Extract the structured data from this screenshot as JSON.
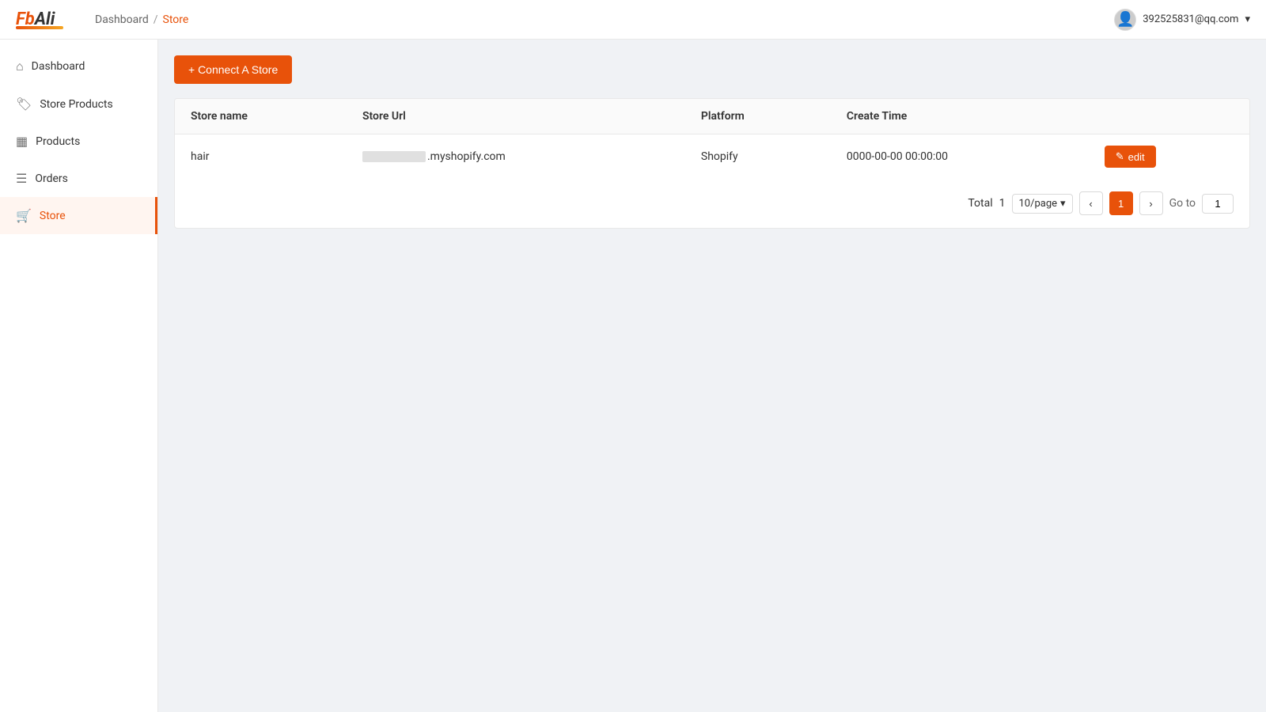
{
  "header": {
    "logo": "FbAli",
    "breadcrumb": {
      "home": "Dashboard",
      "separator": "/",
      "current": "Store"
    },
    "user": {
      "email": "392525831@qq.com",
      "dropdown_icon": "▾"
    }
  },
  "sidebar": {
    "items": [
      {
        "id": "dashboard",
        "label": "Dashboard",
        "icon": "⌂",
        "active": false
      },
      {
        "id": "store-products",
        "label": "Store Products",
        "icon": "🏷",
        "active": false
      },
      {
        "id": "products",
        "label": "Products",
        "icon": "▦",
        "active": false
      },
      {
        "id": "orders",
        "label": "Orders",
        "icon": "☰",
        "active": false
      },
      {
        "id": "store",
        "label": "Store",
        "icon": "🛒",
        "active": true
      }
    ]
  },
  "main": {
    "connect_button": "+ Connect A Store",
    "table": {
      "columns": [
        "Store name",
        "Store Url",
        "Platform",
        "Create Time"
      ],
      "rows": [
        {
          "store_name": "hair",
          "store_url_blurred": "████████",
          "store_url_suffix": ".myshopify.com",
          "platform": "Shopify",
          "create_time": "0000-00-00 00:00:00",
          "edit_label": "edit"
        }
      ]
    },
    "pagination": {
      "total_label": "Total",
      "total_count": "1",
      "per_page": "10/page",
      "current_page": "1",
      "goto_label": "Go to",
      "goto_value": "1",
      "prev_icon": "‹",
      "next_icon": "›"
    }
  }
}
